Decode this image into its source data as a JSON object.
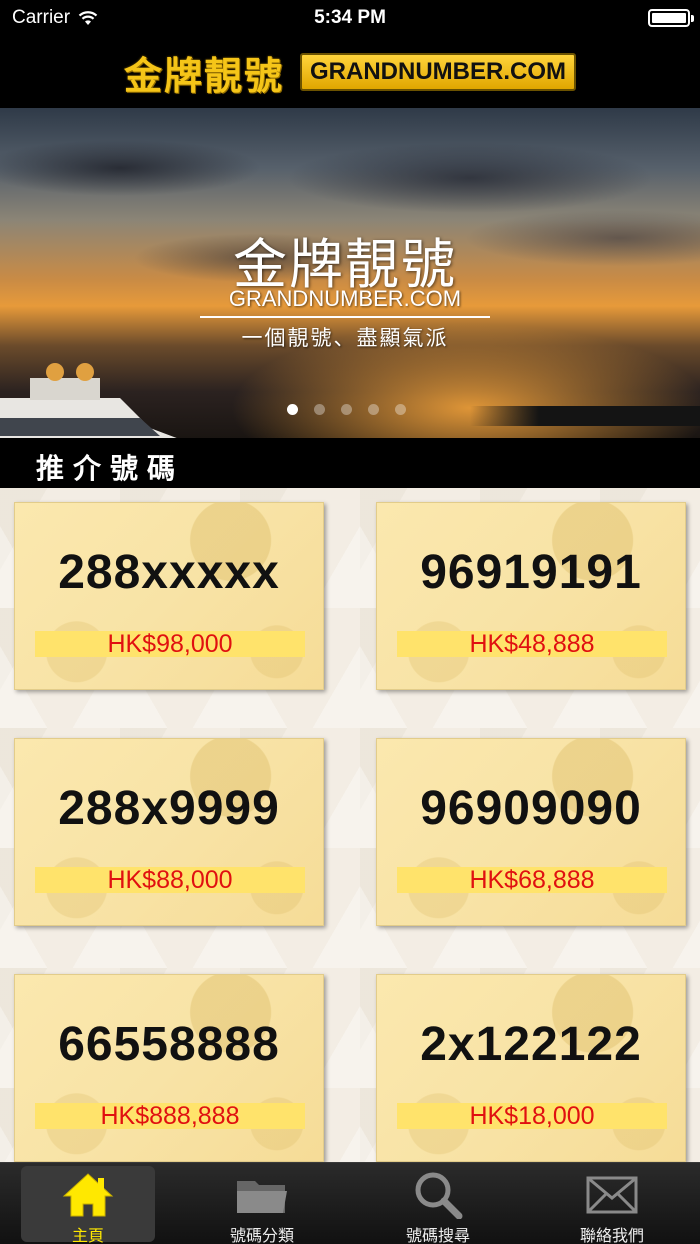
{
  "status_bar": {
    "carrier": "Carrier",
    "time": "5:34 PM"
  },
  "header": {
    "logo_cn": "金牌靚號",
    "logo_en": "GRANDNUMBER.COM"
  },
  "banner": {
    "title": "金牌靚號",
    "subtitle": "GRANDNUMBER.COM",
    "slogan": "一個靚號、盡顯氣派",
    "active_slide": 1,
    "slide_count": 5
  },
  "section": {
    "title": "推介號碼"
  },
  "cards": [
    {
      "number": "288xxxxx",
      "price": "HK$98,000"
    },
    {
      "number": "96919191",
      "price": "HK$48,888"
    },
    {
      "number": "288x9999",
      "price": "HK$88,000"
    },
    {
      "number": "96909090",
      "price": "HK$68,888"
    },
    {
      "number": "66558888",
      "price": "HK$888,888"
    },
    {
      "number": "2x122122",
      "price": "HK$18,000"
    }
  ],
  "tabs": [
    {
      "label": "主頁",
      "icon": "home-icon",
      "active": true
    },
    {
      "label": "號碼分類",
      "icon": "folder-icon",
      "active": false
    },
    {
      "label": "號碼搜尋",
      "icon": "search-icon",
      "active": false
    },
    {
      "label": "聯絡我們",
      "icon": "mail-icon",
      "active": false
    }
  ],
  "colors": {
    "price_text": "#e01010",
    "price_bg": "#ffe36b",
    "active_tab_label": "#ffe800",
    "logo_gold": "#f5c518"
  }
}
